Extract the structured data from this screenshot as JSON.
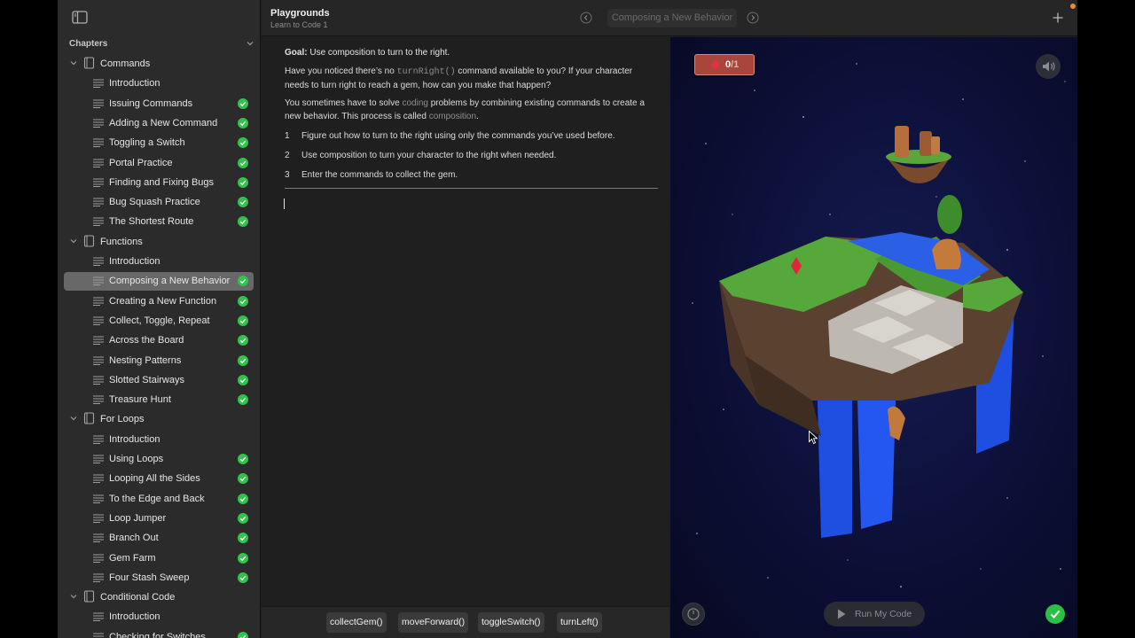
{
  "app": {
    "title": "Playgrounds",
    "subtitle": "Learn to Code 1"
  },
  "topbar": {
    "page_title": "Composing a New Behavior"
  },
  "sidebar": {
    "header": "Chapters",
    "chapters": [
      {
        "label": "Commands",
        "pages": [
          {
            "label": "Introduction",
            "done": false
          },
          {
            "label": "Issuing Commands",
            "done": true
          },
          {
            "label": "Adding a New Command",
            "done": true
          },
          {
            "label": "Toggling a Switch",
            "done": true
          },
          {
            "label": "Portal Practice",
            "done": true
          },
          {
            "label": "Finding and Fixing Bugs",
            "done": true
          },
          {
            "label": "Bug Squash Practice",
            "done": true
          },
          {
            "label": "The Shortest Route",
            "done": true
          }
        ]
      },
      {
        "label": "Functions",
        "pages": [
          {
            "label": "Introduction",
            "done": false
          },
          {
            "label": "Composing a New Behavior",
            "done": true,
            "selected": true
          },
          {
            "label": "Creating a New Function",
            "done": true
          },
          {
            "label": "Collect, Toggle, Repeat",
            "done": true
          },
          {
            "label": "Across the Board",
            "done": true
          },
          {
            "label": "Nesting Patterns",
            "done": true
          },
          {
            "label": "Slotted Stairways",
            "done": true
          },
          {
            "label": "Treasure Hunt",
            "done": true
          }
        ]
      },
      {
        "label": "For Loops",
        "pages": [
          {
            "label": "Introduction",
            "done": false
          },
          {
            "label": "Using Loops",
            "done": true
          },
          {
            "label": "Looping All the Sides",
            "done": true
          },
          {
            "label": "To the Edge and Back",
            "done": true
          },
          {
            "label": "Loop Jumper",
            "done": true
          },
          {
            "label": "Branch Out",
            "done": true
          },
          {
            "label": "Gem Farm",
            "done": true
          },
          {
            "label": "Four Stash Sweep",
            "done": true
          }
        ]
      },
      {
        "label": "Conditional Code",
        "pages": [
          {
            "label": "Introduction",
            "done": false
          },
          {
            "label": "Checking for Switches",
            "done": true
          }
        ]
      }
    ]
  },
  "content": {
    "goal_label": "Goal:",
    "goal_text": "Use composition to turn to the right.",
    "p1_a": "Have you noticed there’s no ",
    "p1_code": "turnRight()",
    "p1_b": " command available to you? If your character needs to turn right to reach a gem, how can you make that happen?",
    "p2_a": "You sometimes have to solve ",
    "p2_link1": "coding",
    "p2_b": " problems by combining existing commands to create a new behavior. This process is called ",
    "p2_link2": "composition",
    "p2_c": ".",
    "steps": [
      {
        "n": "1",
        "text": "Figure out how to turn to the right using only the commands you’ve used before."
      },
      {
        "n": "2",
        "text": "Use composition to turn your character to the right when needed."
      },
      {
        "n": "3",
        "text": "Enter the commands to collect the gem."
      }
    ]
  },
  "shortcuts": [
    "collectGem()",
    "moveForward()",
    "toggleSwitch()",
    "turnLeft()"
  ],
  "scene": {
    "gems_collected": "0",
    "gems_total": "/1",
    "run_label": "Run My Code"
  },
  "colors": {
    "check": "#30c44b",
    "selected_row": "#686868",
    "gem_counter": "#a9463c"
  },
  "icons": [
    "sidebar-toggle-icon",
    "chevron-down-icon",
    "disclosure-icon",
    "book-icon",
    "page-lines-icon",
    "checkmark-icon",
    "chevron-left-icon",
    "chevron-right-icon",
    "plus-icon",
    "speaker-icon",
    "speed-icon",
    "play-icon",
    "gem-icon"
  ]
}
